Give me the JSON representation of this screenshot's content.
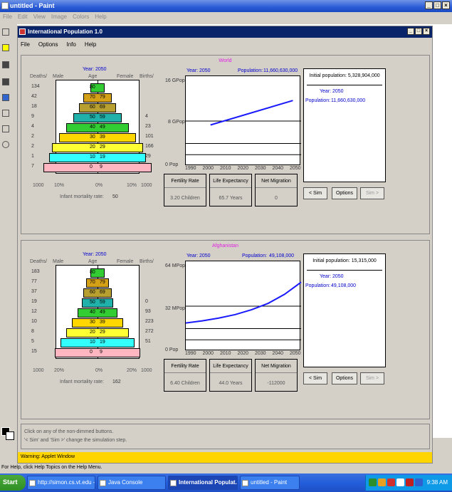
{
  "paint": {
    "title": "untitled - Paint",
    "menu": [
      "File",
      "Edit",
      "View",
      "Image",
      "Colors",
      "Help"
    ],
    "status": "For Help, click Help Topics on the Help Menu."
  },
  "applet": {
    "title": "International Population 1.0",
    "menu": [
      "File",
      "Options",
      "Info",
      "Help"
    ],
    "help_line1": "Click on any of the non-dimmed buttons.",
    "help_line2": "'< Sim' and 'Sim >' change the simulation step.",
    "warning": "Warning: Applet Window"
  },
  "labels": {
    "deaths": "Deaths/",
    "male": "Male",
    "age": "Age",
    "female": "Female",
    "births": "Births/",
    "infant_mortality": "Infant mortality rate:",
    "fertility": "Fertility Rate",
    "life_exp": "Life Expectancy",
    "net_mig": "Net Migration",
    "sim_back": "< Sim",
    "options": "Options",
    "sim_fwd": "Sim >"
  },
  "world": {
    "region": "World",
    "year_label": "Year:",
    "year": "2050",
    "population_label": "Population:",
    "population": "11,660,630,000",
    "initial_population": "Initial population: 5,328,904,000",
    "deaths": [
      "134",
      "42",
      "18",
      "9",
      "4",
      "2",
      "2",
      "1",
      "7"
    ],
    "births": [
      "",
      "",
      "",
      "4",
      "23",
      "101",
      "166",
      "29",
      ""
    ],
    "ages": [
      "80",
      "70",
      "60",
      "50",
      "40",
      "30",
      "20",
      "10",
      "0"
    ],
    "ages_r": [
      "",
      "79",
      "69",
      "59",
      "49",
      "39",
      "29",
      "19",
      "9"
    ],
    "scale_left": "1000",
    "scale_pct_l": "10%",
    "scale_zero": "0%",
    "scale_pct_r": "10%",
    "scale_right": "1000",
    "infant_mortality": "50",
    "fertility": "3.20 Children",
    "life_exp": "65.7 Years",
    "net_mig": "0",
    "y_top": "16 GPop",
    "y_mid": "8 GPop",
    "y_zero": "0 Pop",
    "x_ticks": [
      "1990",
      "2000",
      "2010",
      "2020",
      "2030",
      "2040",
      "2050"
    ]
  },
  "afghanistan": {
    "region": "Afghanistan",
    "year_label": "Year:",
    "year": "2050",
    "population_label": "Population:",
    "population": "49,108,000",
    "initial_population": "Initial population: 15,315,000",
    "deaths": [
      "183",
      "77",
      "37",
      "19",
      "12",
      "10",
      "8",
      "5",
      "15"
    ],
    "births": [
      "",
      "",
      "",
      "0",
      "93",
      "223",
      "272",
      "51",
      ""
    ],
    "ages": [
      "80",
      "70",
      "60",
      "50",
      "40",
      "30",
      "20",
      "10",
      "0"
    ],
    "ages_r": [
      "",
      "79",
      "69",
      "59",
      "49",
      "39",
      "29",
      "19",
      "9"
    ],
    "scale_left": "1000",
    "scale_pct_l": "20%",
    "scale_zero": "0%",
    "scale_pct_r": "20%",
    "scale_right": "1000",
    "infant_mortality": "162",
    "fertility": "6.40 Children",
    "life_exp": "44.0 Years",
    "net_mig": "-112000",
    "y_top": "64 MPop",
    "y_mid": "32 MPop",
    "y_zero": "0 Pop",
    "x_ticks": [
      "1990",
      "2000",
      "2010",
      "2020",
      "2030",
      "2040",
      "2050"
    ]
  },
  "taskbar": {
    "start": "Start",
    "tasks": [
      "http://simon.cs.vt.edu - ...",
      "Java Console",
      "International Populat...",
      "untitled - Paint"
    ],
    "time": "9:38 AM"
  },
  "chart_data": [
    {
      "type": "line",
      "title": "World",
      "x": [
        2000,
        2050
      ],
      "series": [
        {
          "values": [
            7.3,
            11.66
          ]
        }
      ],
      "ylim": [
        0,
        16
      ],
      "xlim": [
        1985,
        2055
      ]
    },
    {
      "type": "line",
      "title": "Afghanistan",
      "x": [
        1985,
        1995,
        2005,
        2015,
        2025,
        2035,
        2045,
        2055
      ],
      "series": [
        {
          "values": [
            20,
            21.5,
            23.5,
            26,
            29.5,
            34,
            40.5,
            49.1
          ]
        }
      ],
      "ylim": [
        0,
        64
      ],
      "xlim": [
        1985,
        2055
      ]
    }
  ]
}
